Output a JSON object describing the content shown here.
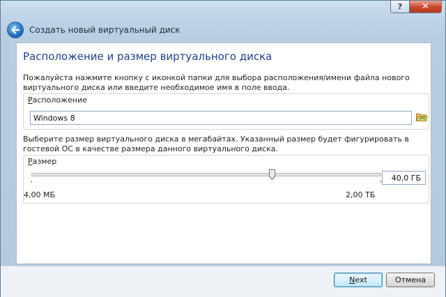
{
  "window": {
    "help_label": "?",
    "close_label": "✕"
  },
  "header": {
    "title": "Создать новый виртуальный диск"
  },
  "page": {
    "title": "Расположение и размер виртуального диска",
    "location_description": "Пожалуйста нажмите кнопку с иконкой папки для выбора расположения/имени файла нового виртуального диска или введите необходимое имя в поле ввода.",
    "size_description": "Выберите размер виртуального диска в мегабайтах. Указанный размер будет фигурировать в гостевой ОС в качестве размера данного виртуального диска."
  },
  "location": {
    "label_prefix": "Р",
    "label_rest": "асположение",
    "value": "Windows 8"
  },
  "size": {
    "label_prefix": "Р",
    "label_rest": "азмер",
    "value": "40,0 ГБ",
    "min_label": "4,00 МБ",
    "max_label": "2,00 ТБ",
    "slider_fraction": 0.69
  },
  "footer": {
    "next_prefix": "N",
    "next_rest": "ext",
    "cancel_label": "Отмена"
  },
  "colors": {
    "title_blue": "#1e3f8a",
    "close_red": "#c9462b"
  },
  "icons": {
    "back": "back-arrow-icon",
    "folder": "folder-icon",
    "close": "close-icon",
    "help": "help-icon"
  }
}
